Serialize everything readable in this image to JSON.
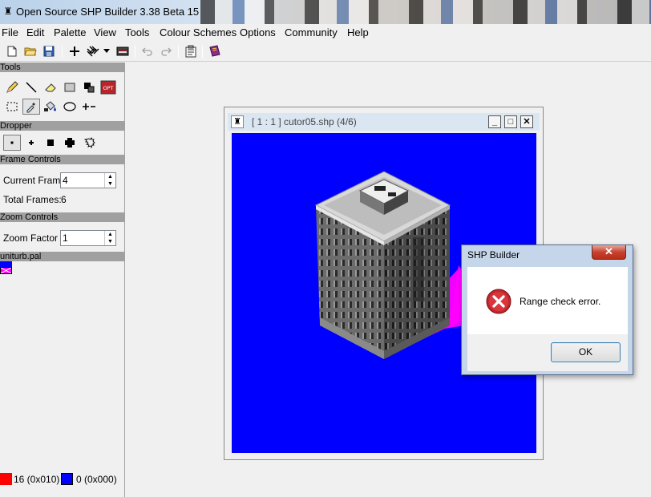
{
  "window": {
    "title": "Open Source SHP Builder 3.38 Beta 15"
  },
  "menu": [
    "File",
    "Edit",
    "Palette",
    "View",
    "Tools",
    "Colour Schemes",
    "Options",
    "Community",
    "Help"
  ],
  "toolbar": {
    "icons": [
      "new-file-icon",
      "open-folder-icon",
      "save-icon",
      "crosshair-icon",
      "grid-icon",
      "dropdown-arrow-icon",
      "preview-icon",
      "undo-icon",
      "redo-icon",
      "properties-icon",
      "palette-book-icon"
    ]
  },
  "panel": {
    "tools_header": "Tools",
    "opt_label": "OPT",
    "dropper_header": "Dropper",
    "frame_header": "Frame Controls",
    "current_frame_label": "Current Frame",
    "current_frame_value": "4",
    "total_frames_label": "Total Frames:",
    "total_frames_value": "6",
    "zoom_header": "Zoom Controls",
    "zoom_label": "Zoom Factor",
    "zoom_value": "1",
    "palette_header": "uniturb.pal"
  },
  "colors": {
    "primary_label": "16 (0x010)",
    "primary_color": "#ff0000",
    "secondary_label": "0 (0x000)",
    "secondary_color": "#0000ff",
    "canvas_background": "#0000ff",
    "shadow_color": "#ff00ff"
  },
  "canvas_window": {
    "title": "[ 1 : 1 ] cutor05.shp (4/6)"
  },
  "dialog": {
    "title": "SHP Builder",
    "message": "Range check error.",
    "ok_label": "OK",
    "close_label": "✕",
    "icon": "error-icon"
  }
}
